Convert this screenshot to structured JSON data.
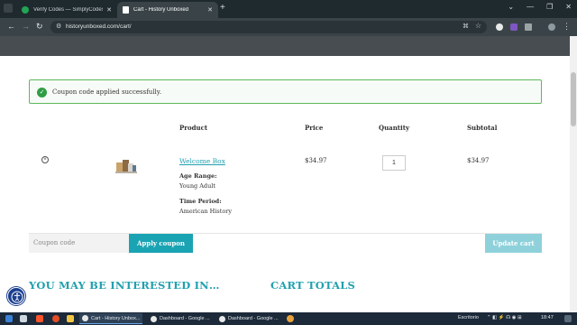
{
  "browser": {
    "tabs": [
      {
        "title": "Verify Codes — SimplyCodes",
        "active": false
      },
      {
        "title": "Cart - History Unboxed",
        "active": true
      }
    ],
    "new_tab": "+",
    "url": "historyunboxed.com/cart/",
    "window_controls": [
      "⌄",
      "—",
      "❐",
      "✕"
    ]
  },
  "notice": {
    "message": "Coupon code applied successfully."
  },
  "cart": {
    "headers": {
      "product": "Product",
      "price": "Price",
      "quantity": "Quantity",
      "subtotal": "Subtotal"
    },
    "items": [
      {
        "name": "Welcome Box",
        "price": "$34.97",
        "quantity": "1",
        "subtotal": "$34.97",
        "meta": [
          {
            "label": "Age Range:",
            "value": "Young Adult"
          },
          {
            "label": "Time Period:",
            "value": "American History"
          }
        ]
      }
    ],
    "coupon_placeholder": "Coupon code",
    "apply_label": "Apply coupon",
    "update_label": "Update cart"
  },
  "sections": {
    "interested": "YOU MAY BE INTERESTED IN…",
    "totals": "CART TOTALS"
  },
  "taskbar": {
    "apps": [
      {
        "label": "Cart - History Unbox...",
        "active": true
      },
      {
        "label": "Dashboard - Google ...",
        "active": false
      },
      {
        "label": "Dashboard - Google ...",
        "active": false
      }
    ],
    "desktop_label": "Escritorio",
    "time": "18:47"
  },
  "colors": {
    "accent": "#1aa3b3",
    "success": "#2e9e44",
    "update_disabled": "#8fd1db"
  }
}
